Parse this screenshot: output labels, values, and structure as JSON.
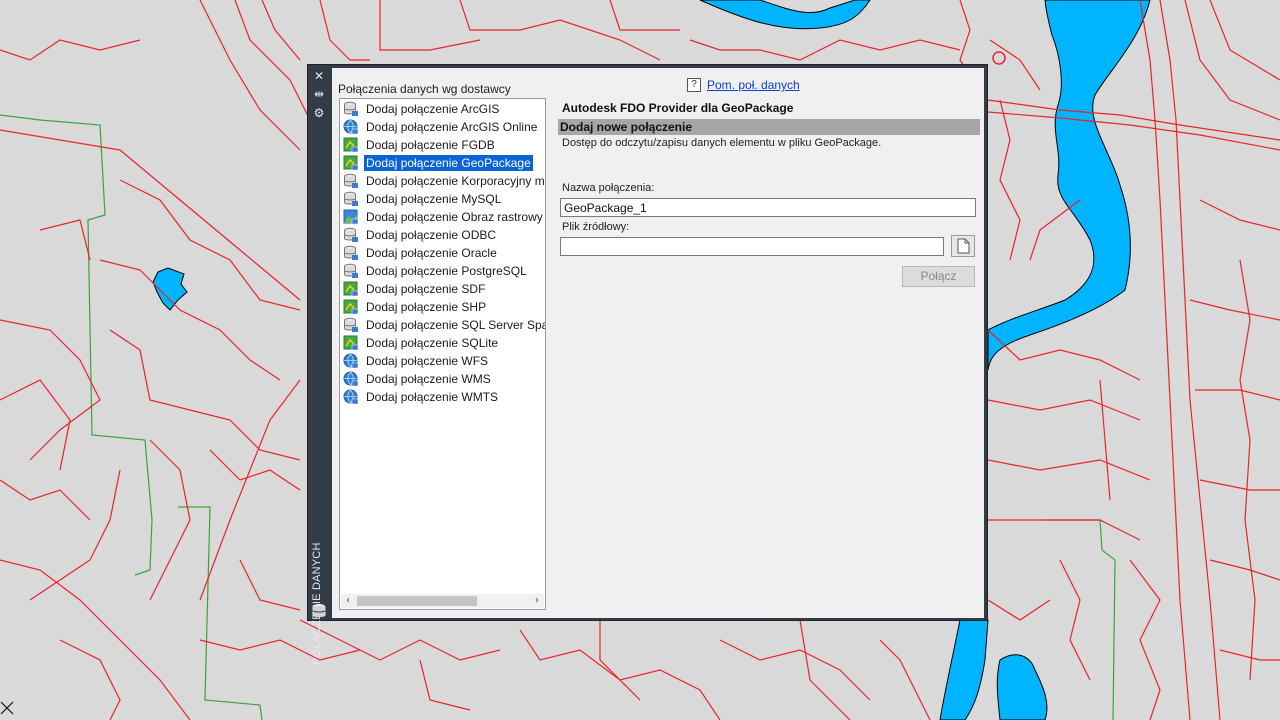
{
  "colors": {
    "map_background": "#d9d9d9",
    "road": "#e8242a",
    "water": "#00b4ff",
    "boundary": "#3ca33c",
    "palette_frame": "#333b47",
    "selection": "#0a64d6",
    "section_bar": "#a6a6a6"
  },
  "palette": {
    "side_title": "POŁĄCZENIE DANYCH",
    "buttons": [
      "close-icon",
      "auto-hide-icon",
      "properties-icon"
    ]
  },
  "list": {
    "header": "Połączenia danych wg dostawcy",
    "items": [
      {
        "label": "Dodaj połączenie ArcGIS",
        "icon": "database-icon"
      },
      {
        "label": "Dodaj połączenie ArcGIS Online",
        "icon": "globe-icon"
      },
      {
        "label": "Dodaj połączenie FGDB",
        "icon": "vector-file-icon"
      },
      {
        "label": "Dodaj połączenie GeoPackage",
        "icon": "vector-file-icon",
        "selected": true
      },
      {
        "label": "Dodaj połączenie Korporacyjny mo",
        "icon": "database-icon"
      },
      {
        "label": "Dodaj połączenie MySQL",
        "icon": "database-icon"
      },
      {
        "label": "Dodaj połączenie Obraz rastrowy lu",
        "icon": "raster-icon"
      },
      {
        "label": "Dodaj połączenie ODBC",
        "icon": "database-icon"
      },
      {
        "label": "Dodaj połączenie Oracle",
        "icon": "database-icon"
      },
      {
        "label": "Dodaj połączenie PostgreSQL",
        "icon": "database-icon"
      },
      {
        "label": "Dodaj połączenie SDF",
        "icon": "vector-file-icon"
      },
      {
        "label": "Dodaj połączenie SHP",
        "icon": "vector-file-icon"
      },
      {
        "label": "Dodaj połączenie SQL Server Spatia",
        "icon": "database-icon"
      },
      {
        "label": "Dodaj połączenie SQLite",
        "icon": "vector-file-icon"
      },
      {
        "label": "Dodaj połączenie WFS",
        "icon": "globe-icon"
      },
      {
        "label": "Dodaj połączenie WMS",
        "icon": "globe-icon"
      },
      {
        "label": "Dodaj połączenie WMTS",
        "icon": "globe-icon"
      }
    ]
  },
  "details": {
    "help_link": "Pom. poł. danych",
    "provider_title": "Autodesk FDO Provider dla GeoPackage",
    "section_title": "Dodaj nowe połączenie",
    "description": "Dostęp do odczytu/zapisu danych elementu w pliku GeoPackage.",
    "name_label": "Nazwa połączenia:",
    "name_value": "GeoPackage_1",
    "file_label": "Plik źródłowy:",
    "file_value": "",
    "connect_button": "Połącz"
  }
}
